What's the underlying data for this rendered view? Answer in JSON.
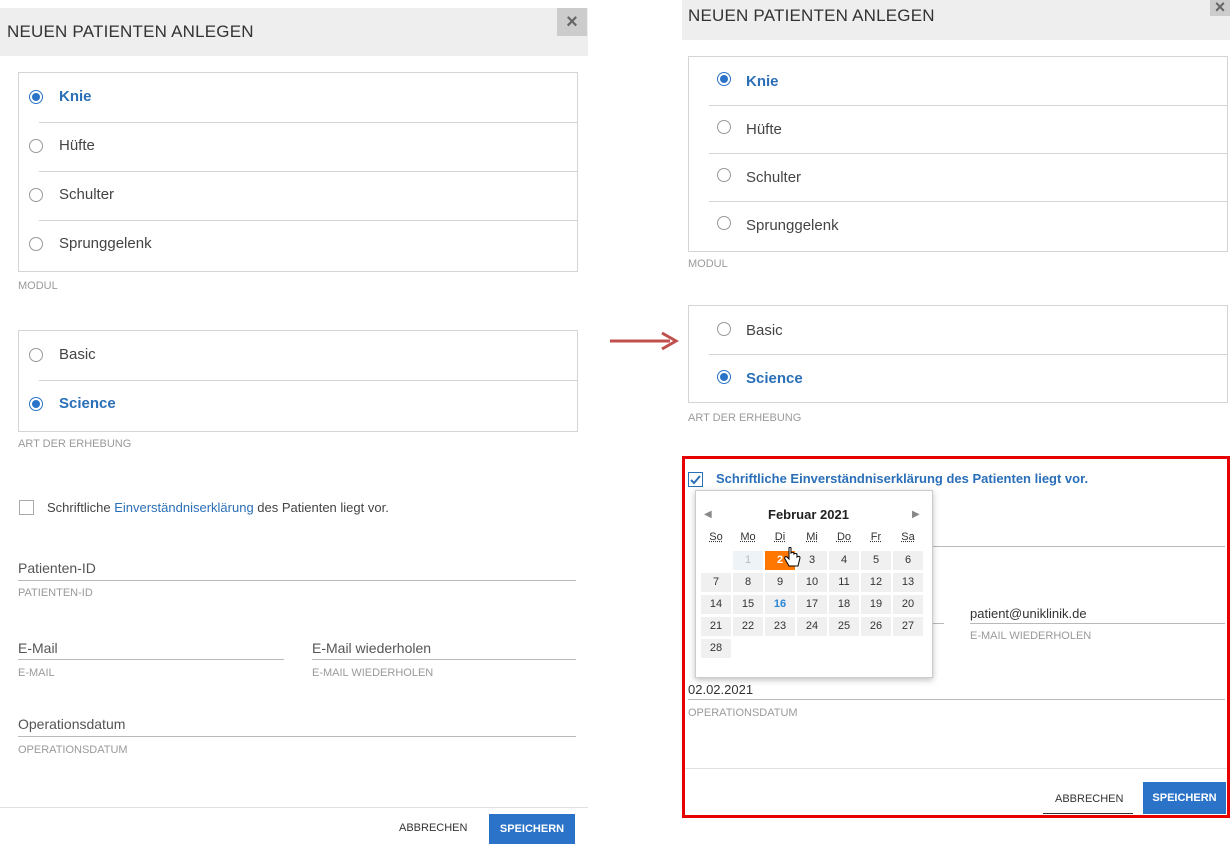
{
  "left": {
    "title": "NEUEN PATIENTEN ANLEGEN",
    "close": "×",
    "modul_options": [
      {
        "label": "Knie",
        "selected": true
      },
      {
        "label": "Hüfte",
        "selected": false
      },
      {
        "label": "Schulter",
        "selected": false
      },
      {
        "label": "Sprunggelenk",
        "selected": false
      }
    ],
    "modul_caption": "MODUL",
    "art_options": [
      {
        "label": "Basic",
        "selected": false
      },
      {
        "label": "Science",
        "selected": true
      }
    ],
    "art_caption": "ART DER ERHEBUNG",
    "consent": {
      "pre": "Schriftliche ",
      "link": "Einverständniserklärung",
      "post": " des Patienten liegt vor.",
      "checked": false
    },
    "patient_id": {
      "placeholder": "Patienten-ID",
      "caption": "PATIENTEN-ID"
    },
    "email": {
      "placeholder": "E-Mail",
      "caption": "E-MAIL"
    },
    "email_repeat": {
      "placeholder": "E-Mail wiederholen",
      "caption": "E-MAIL WIEDERHOLEN"
    },
    "op_date": {
      "placeholder": "Operationsdatum",
      "caption": "OPERATIONSDATUM"
    },
    "cancel": "ABBRECHEN",
    "save": "SPEICHERN"
  },
  "right": {
    "title": "NEUEN PATIENTEN ANLEGEN",
    "close": "×",
    "modul_options": [
      {
        "label": "Knie",
        "selected": true
      },
      {
        "label": "Hüfte",
        "selected": false
      },
      {
        "label": "Schulter",
        "selected": false
      },
      {
        "label": "Sprunggelenk",
        "selected": false
      }
    ],
    "modul_caption": "MODUL",
    "art_options": [
      {
        "label": "Basic",
        "selected": false
      },
      {
        "label": "Science",
        "selected": true
      }
    ],
    "art_caption": "ART DER ERHEBUNG",
    "consent": {
      "text": "Schriftliche Einverständniserklärung des Patienten liegt vor.",
      "checked": true
    },
    "email_repeat": {
      "value": "patient@uniklinik.de",
      "caption": "E-MAIL WIEDERHOLEN"
    },
    "op_date": {
      "value": "02.02.2021",
      "caption": "OPERATIONSDATUM"
    },
    "cancel": "ABBRECHEN",
    "save": "SPEICHERN",
    "calendar": {
      "month_label": "Februar 2021",
      "prev": "◀",
      "next": "▶",
      "weekdays": [
        "So",
        "Mo",
        "Di",
        "Mi",
        "Do",
        "Fr",
        "Sa"
      ],
      "weeks": [
        [
          "",
          "1",
          "2",
          "3",
          "4",
          "5",
          "6"
        ],
        [
          "7",
          "8",
          "9",
          "10",
          "11",
          "12",
          "13"
        ],
        [
          "14",
          "15",
          "16",
          "17",
          "18",
          "19",
          "20"
        ],
        [
          "21",
          "22",
          "23",
          "24",
          "25",
          "26",
          "27"
        ],
        [
          "28",
          "",
          "",
          "",
          "",
          "",
          ""
        ]
      ],
      "selected_day": "2",
      "today_day": "16",
      "muted_day": "1"
    }
  },
  "colors": {
    "accent": "#2a73c8",
    "selected_date": "#ff7700",
    "highlight_frame": "#e60000",
    "arrow": "#c0504d"
  }
}
